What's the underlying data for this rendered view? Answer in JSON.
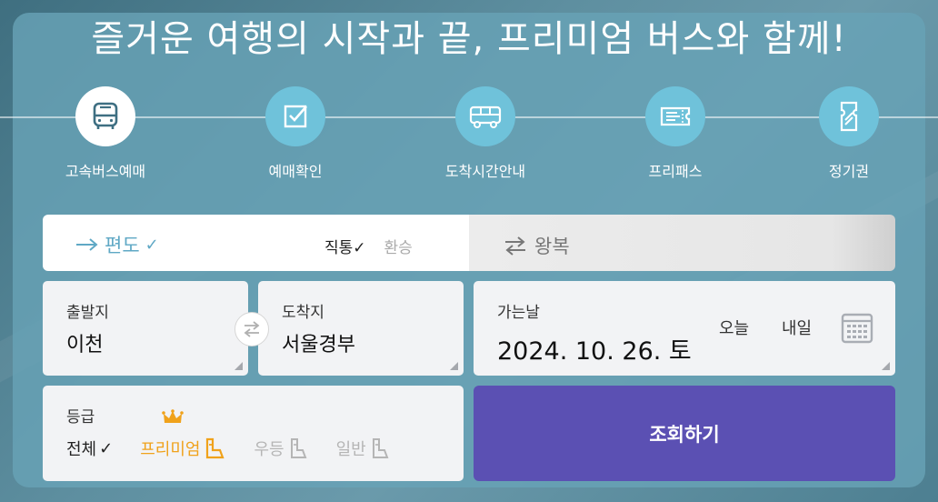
{
  "headline": "즐거운 여행의 시작과 끝, 프리미엄 버스와 함께!",
  "nav": [
    {
      "label": "고속버스예매",
      "icon": "bus-icon"
    },
    {
      "label": "예매확인",
      "icon": "checkbox-icon"
    },
    {
      "label": "도착시간안내",
      "icon": "bus-arrival-icon"
    },
    {
      "label": "프리패스",
      "icon": "ticket-icon"
    },
    {
      "label": "정기권",
      "icon": "pass-card-icon"
    }
  ],
  "trip": {
    "oneway_label": "편도",
    "direct_label": "직통",
    "transfer_label": "환승",
    "round_label": "왕복",
    "check_mark": "✓",
    "active_color": "#5fa8c5"
  },
  "departure": {
    "label": "출발지",
    "value": "이천"
  },
  "arrival": {
    "label": "도착지",
    "value": "서울경부"
  },
  "date": {
    "label": "가는날",
    "value": "2024. 10. 26. 토",
    "today": "오늘",
    "tomorrow": "내일"
  },
  "grade": {
    "label": "등급",
    "options": [
      {
        "label": "전체",
        "state": "checked"
      },
      {
        "label": "프리미엄",
        "state": "highlight"
      },
      {
        "label": "우등",
        "state": "off"
      },
      {
        "label": "일반",
        "state": "off"
      }
    ],
    "check_mark": "✓",
    "premium_color": "#f0a21b"
  },
  "search_button": {
    "label": "조회하기",
    "color": "#5b50b3"
  }
}
